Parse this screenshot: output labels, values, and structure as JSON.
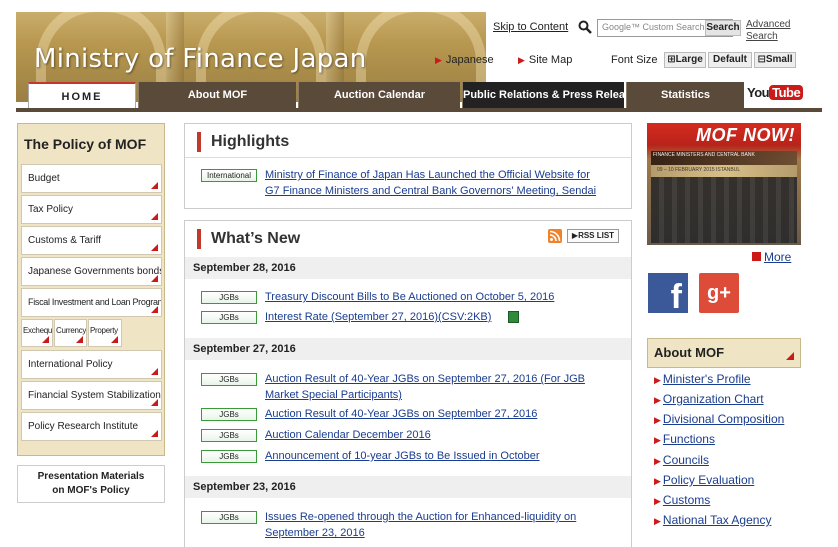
{
  "header": {
    "site_title": "Ministry of Finance Japan",
    "skip_link": "Skip to Content",
    "search_placeholder": "Google™ Custom Search",
    "search_button": "Search",
    "advanced_search": "Advanced Search",
    "links": {
      "japanese": "Japanese",
      "site_map": "Site Map"
    },
    "font_size": {
      "label": "Font Size",
      "large": "Large",
      "default": "Default",
      "small": "Small"
    }
  },
  "nav": {
    "tabs": [
      "HOME",
      "About MOF",
      "Auction Calendar",
      "Public Relations & Press Release",
      "Statistics"
    ],
    "youtube": {
      "you": "You",
      "tube": "Tube"
    }
  },
  "policy": {
    "title": "The Policy of MOF",
    "items": [
      "Budget",
      "Tax Policy",
      "Customs & Tariff",
      "Japanese Governments bonds",
      "Fiscal Investment and Loan Program"
    ],
    "sub_items": [
      "Exchequer",
      "Currency",
      "Property"
    ],
    "items2": [
      "International Policy",
      "Financial System Stabilization",
      "Policy Research Institute"
    ],
    "presentation": [
      "Presentation Materials",
      "on MOF's Policy"
    ]
  },
  "highlights": {
    "title": "Highlights",
    "badge": "International",
    "link_lines": [
      "Ministry of Finance of Japan Has Launched the Official Website for",
      "G7 Finance Ministers and Central Bank Governors' Meeting, Sendai"
    ]
  },
  "whats_new": {
    "title": "What’s New",
    "rss_list": "RSS LIST",
    "groups": [
      {
        "date": "September 28, 2016",
        "items": [
          {
            "badge": "JGBs",
            "text": "Treasury Discount Bills to Be Auctioned on October 5, 2016"
          },
          {
            "badge": "JGBs",
            "text": "Interest Rate (September 27, 2016)(CSV:2KB)"
          }
        ]
      },
      {
        "date": "September 27, 2016",
        "items": [
          {
            "badge": "JGBs",
            "text": "Auction Result of 40-Year JGBs on September 27, 2016 (For JGB",
            "text2": "Market Special Participants)"
          },
          {
            "badge": "JGBs",
            "text": "Auction Result of 40-Year JGBs on September 27, 2016"
          },
          {
            "badge": "JGBs",
            "text": "Auction Calendar December 2016"
          },
          {
            "badge": "JGBs",
            "text": "Announcement of 10-year JGBs to Be Issued in October"
          }
        ]
      },
      {
        "date": "September 23, 2016",
        "items": [
          {
            "badge": "JGBs",
            "text": "Issues Re-opened through the Auction for Enhanced-liquidity on",
            "text2": "September 23, 2016"
          }
        ]
      }
    ]
  },
  "right": {
    "mof_now": "MOF NOW!",
    "photo_caption": "FINANCE MINISTERS AND CENTRAL BANK",
    "photo_caption2": "09 – 10 FEBRUARY 2015  ISTANBUL",
    "more": "More",
    "facebook": "f",
    "gplus": "g+",
    "about_title": "About MOF",
    "about_links": [
      "Minister's Profile",
      "Organization Chart",
      "Divisional Composition",
      "Functions",
      "Councils",
      "Policy Evaluation",
      "Customs",
      "National Tax Agency"
    ]
  },
  "colors": {
    "accent_red": "#cc1a1a",
    "nav_brown": "#5a4a3a",
    "sidebar_tan": "#efe4c4",
    "link_blue": "#1a3d8f"
  }
}
